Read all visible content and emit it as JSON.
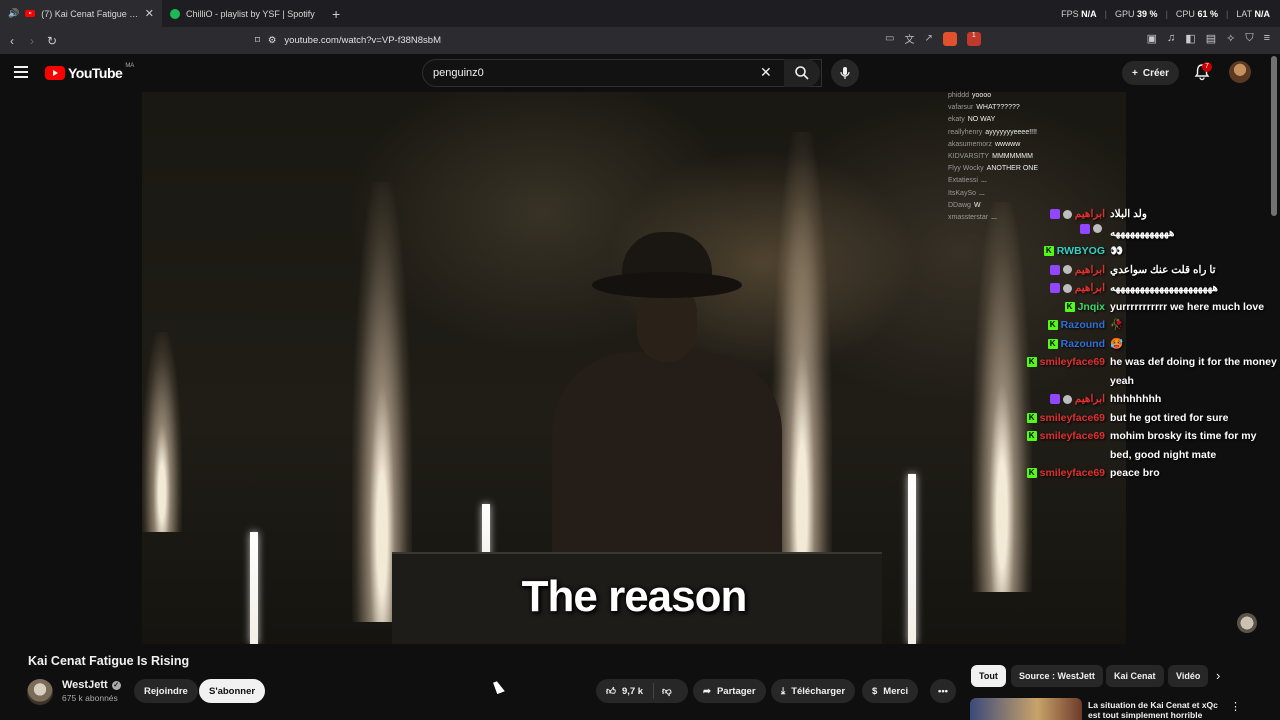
{
  "browser": {
    "tabs": [
      {
        "label": "(7) Kai Cenat Fatigue Is Rising",
        "favicon": "youtube-icon",
        "active": true
      },
      {
        "label": "ChilliO - playlist by YSF | Spotify",
        "favicon": "spotify-icon",
        "active": false
      }
    ],
    "stats": {
      "fps_label": "FPS",
      "fps_value": "N/A",
      "gpu_label": "GPU",
      "gpu_value": "39 %",
      "cpu_label": "CPU",
      "cpu_value": "61 %",
      "lat_label": "LAT",
      "lat_value": "N/A"
    },
    "url": "youtube.com/watch?v=VP-f38N8sbM",
    "extension_badge": "1"
  },
  "youtube": {
    "logo_text": "YouTube",
    "logo_country": "MA",
    "search_value": "penguinz0",
    "create_label": "Créer",
    "notifications_count": "7"
  },
  "video": {
    "caption": "The reason",
    "title": "Kai Cenat Fatigue Is Rising"
  },
  "chat_small": [
    {
      "user": "phiddd",
      "text": "yoooo"
    },
    {
      "user": "vafarsur",
      "text": "WHAT??????"
    },
    {
      "user": "ekaty",
      "text": "NO WAY"
    },
    {
      "user": "reallyhenry",
      "text": "ayyyyyyyeeee!!!!"
    },
    {
      "user": "akasumemorz",
      "text": "wwwww"
    },
    {
      "user": "KIDVARSITY",
      "text": "MMMMMMM"
    },
    {
      "user": "Flyy Wocky",
      "text": "ANOTHER ONE"
    },
    {
      "user": "Extatiessi",
      "text": "..."
    },
    {
      "user": "ItsKaySo",
      "text": "..."
    },
    {
      "user": "DDawg",
      "text": "W"
    },
    {
      "user": "xmassterstar",
      "text": "..."
    }
  ],
  "chat": [
    {
      "user": "ابراهيم",
      "user_color": "#e03030",
      "platform": "twitch",
      "text": "ولد البلاد"
    },
    {
      "user": "",
      "user_color": "#e03030",
      "platform": "twitch",
      "text": "ههههههههههههه"
    },
    {
      "user": "RWBYOG",
      "user_color": "#35d0c6",
      "platform": "kick",
      "text": "👀"
    },
    {
      "user": "ابراهيم",
      "user_color": "#e03030",
      "platform": "twitch",
      "text": "تا راه قلت عنك سواعدي"
    },
    {
      "user": "ابراهيم",
      "user_color": "#e03030",
      "platform": "twitch",
      "text": "هههههههههههههههههههههه"
    },
    {
      "user": "Jnqix",
      "user_color": "#3ad76a",
      "platform": "kick",
      "text": "yurrrrrrrrrrr we here much love"
    },
    {
      "user": "Razound",
      "user_color": "#2e6fd8",
      "platform": "kick",
      "text": "🥀"
    },
    {
      "user": "Razound",
      "user_color": "#2e6fd8",
      "platform": "kick",
      "text": "🥵"
    },
    {
      "user": "smileyface69",
      "user_color": "#e03030",
      "platform": "kick",
      "text": "he was def doing it for the money yeah"
    },
    {
      "user": "ابراهيم",
      "user_color": "#e03030",
      "platform": "twitch",
      "text": "hhhhhhhh"
    },
    {
      "user": "smileyface69",
      "user_color": "#e03030",
      "platform": "kick",
      "text": "but he got tired for sure"
    },
    {
      "user": "smileyface69",
      "user_color": "#e03030",
      "platform": "kick",
      "text": "mohim brosky its time for my bed, good night mate"
    },
    {
      "user": "smileyface69",
      "user_color": "#e03030",
      "platform": "kick",
      "text": "peace bro"
    }
  ],
  "channel": {
    "name": "WestJett",
    "subscribers": "675 k abonnés",
    "join_label": "Rejoindre",
    "subscribe_label": "S'abonner"
  },
  "actions": {
    "likes": "9,7 k",
    "share_label": "Partager",
    "download_label": "Télécharger",
    "thanks_label": "Merci"
  },
  "chips": [
    "Tout",
    "Source : WestJett",
    "Kai Cenat",
    "Vidéo"
  ],
  "recommendation": {
    "title": "La situation de Kai Cenat et xQc est tout simplement horrible"
  }
}
